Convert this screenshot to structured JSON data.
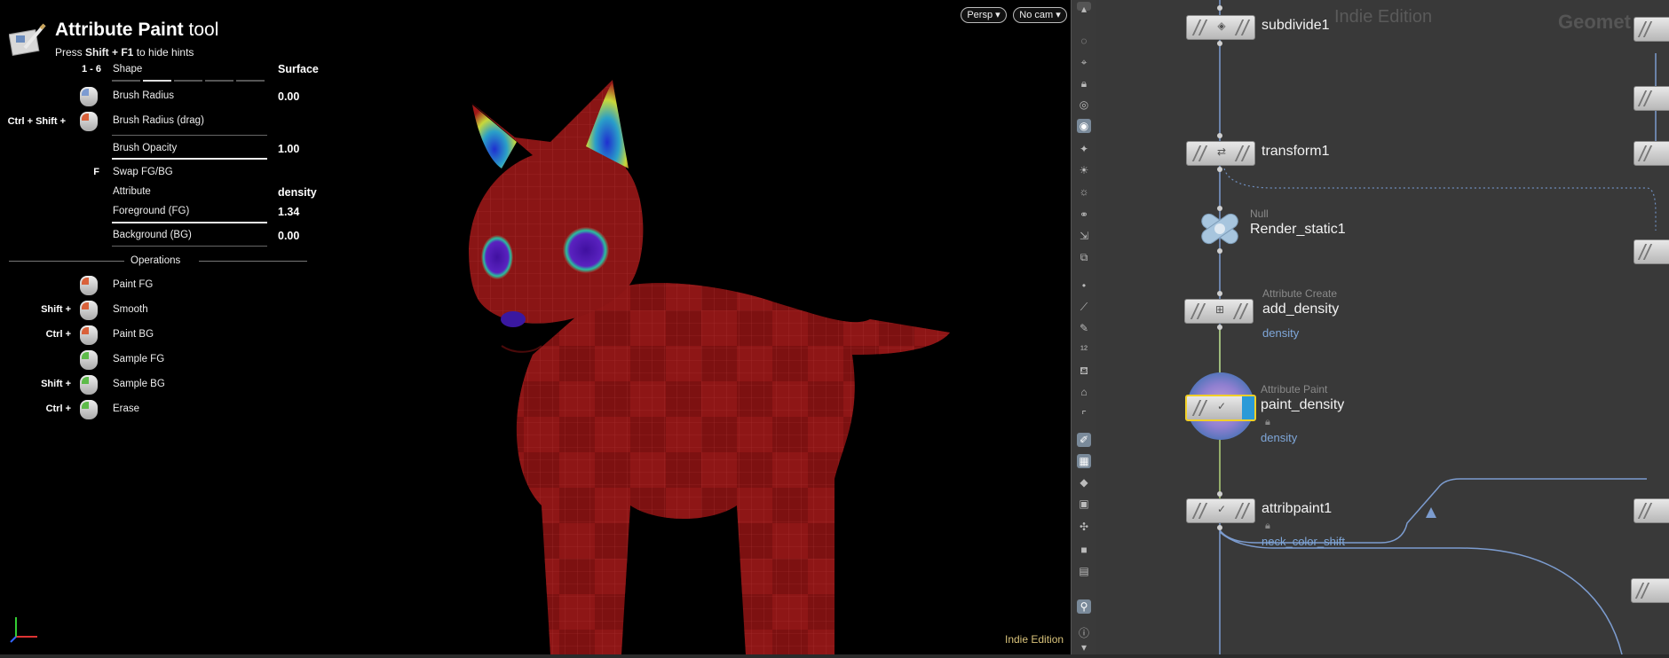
{
  "hud": {
    "title_bold": "Attribute Paint",
    "title_rest": " tool",
    "hint_pre": "Press ",
    "hint_keys": "Shift + F1",
    "hint_post": " to hide hints",
    "shape_keys": "1 - 6",
    "shape_label": "Shape",
    "shape_value": "Surface",
    "brush_radius_label": "Brush Radius",
    "brush_radius_value": "0.00",
    "brush_radius_drag_keys": "Ctrl + Shift +",
    "brush_radius_drag_label": "Brush Radius (drag)",
    "brush_opacity_label": "Brush Opacity",
    "brush_opacity_value": "1.00",
    "swap_key": "F",
    "swap_label": "Swap FG/BG",
    "attribute_label": "Attribute",
    "attribute_value": "density",
    "fg_label": "Foreground (FG)",
    "fg_value": "1.34",
    "bg_label": "Background (BG)",
    "bg_value": "0.00",
    "operations_header": "Operations",
    "operations": [
      {
        "keys": "",
        "label": "Paint FG"
      },
      {
        "keys": "Shift +",
        "label": "Smooth"
      },
      {
        "keys": "Ctrl +",
        "label": "Paint BG"
      },
      {
        "keys": "",
        "label": "Sample FG"
      },
      {
        "keys": "Shift +",
        "label": "Sample BG"
      },
      {
        "keys": "Ctrl +",
        "label": "Erase"
      }
    ]
  },
  "viewport": {
    "persp_label": "Persp ▾",
    "cam_label": "No cam ▾",
    "edition": "Indie Edition"
  },
  "network": {
    "watermark_edition": "Indie Edition",
    "watermark_context": "Geomet",
    "nodes": [
      {
        "name": "subdivide1",
        "type": "",
        "attr": ""
      },
      {
        "name": "transform1",
        "type": "",
        "attr": ""
      },
      {
        "name": "Render_static1",
        "type": "Null",
        "attr": ""
      },
      {
        "name": "add_density",
        "type": "Attribute Create",
        "attr": "density"
      },
      {
        "name": "paint_density",
        "type": "Attribute Paint",
        "attr": "density"
      },
      {
        "name": "attribpaint1",
        "type": "",
        "attr": "neck_color_shift"
      }
    ]
  },
  "colors": {
    "viewport_bg": "#000000",
    "network_bg": "#393939",
    "model_red": "#8b1414",
    "selected_outline": "#f2d028",
    "attr_blue": "#7fa7d9",
    "edition_yellow": "#d8c27a"
  }
}
